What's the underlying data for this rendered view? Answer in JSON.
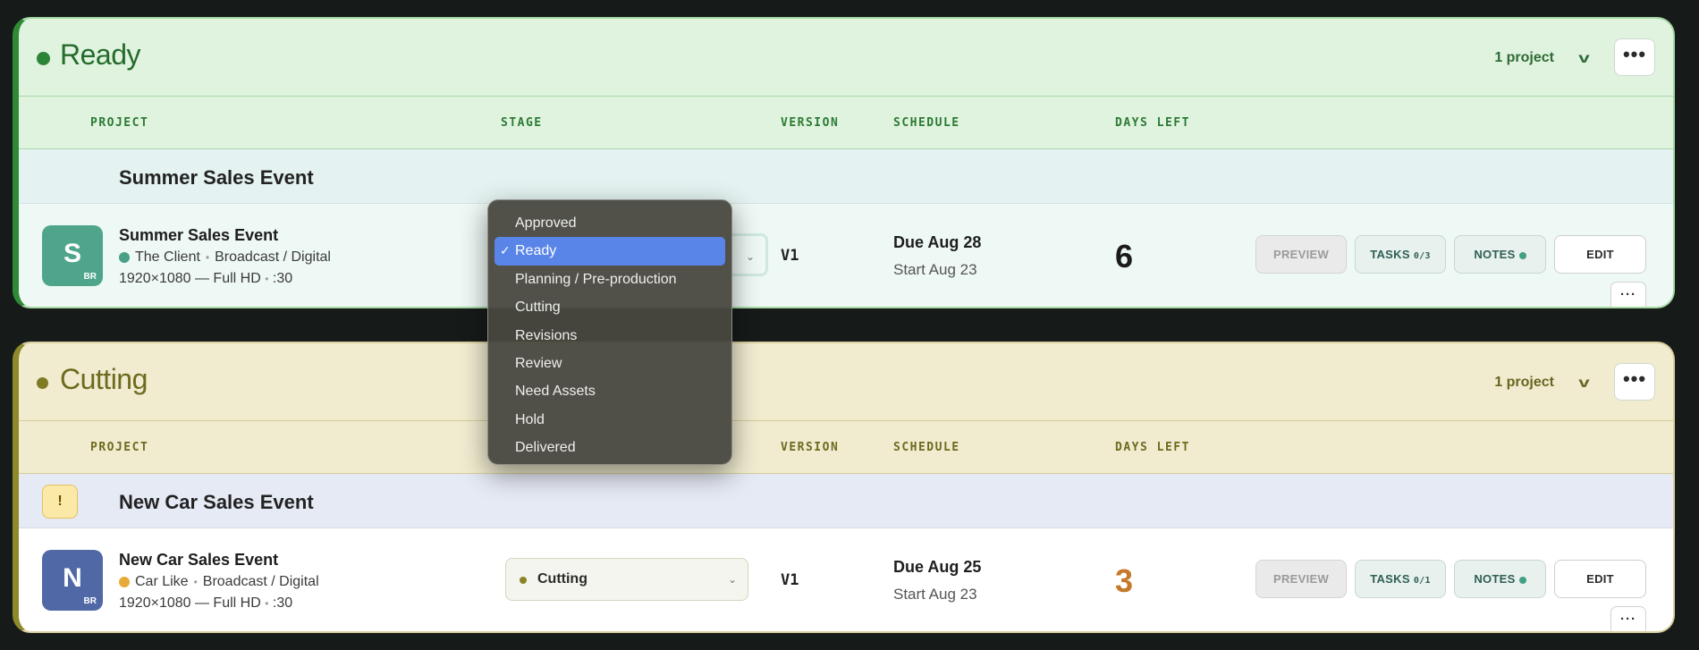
{
  "columns": {
    "project": "PROJECT",
    "stage": "STAGE",
    "version": "VERSION",
    "schedule": "SCHEDULE",
    "days_left": "DAYS LEFT"
  },
  "panels": [
    {
      "status": "Ready",
      "count": "1 project",
      "color": "#2f8a35",
      "group_title": "Summer Sales Event",
      "project": {
        "avatar_letter": "S",
        "avatar_sub": "BR",
        "name": "Summer Sales Event",
        "client": "The Client",
        "type": "Broadcast / Digital",
        "spec": "1920×1080 — Full HD",
        "duration": ":30",
        "version": "V1",
        "due": "Due Aug 28",
        "start": "Start Aug 23",
        "days_left": "6"
      }
    },
    {
      "status": "Cutting",
      "count": "1 project",
      "color": "#8e8a2b",
      "group_title": "New Car Sales Event",
      "warning": "!",
      "project": {
        "avatar_letter": "N",
        "avatar_sub": "BR",
        "name": "New Car Sales Event",
        "client": "Car Like",
        "type": "Broadcast / Digital",
        "spec": "1920×1080 — Full HD",
        "duration": ":30",
        "stage": "Cutting",
        "version": "V1",
        "due": "Due Aug 25",
        "start": "Start Aug 23",
        "days_left": "3"
      }
    }
  ],
  "actions": {
    "preview": "PREVIEW",
    "tasks": "TASKS",
    "tasks_count_ready": "0/3",
    "tasks_count_cutting": "0/1",
    "notes": "NOTES",
    "edit": "EDIT",
    "more": "•••",
    "more_small": "···"
  },
  "stage_dropdown": {
    "selected": "Ready",
    "check": "✓",
    "options": [
      "Approved",
      "Ready",
      "Planning / Pre-production",
      "Cutting",
      "Revisions",
      "Review",
      "Need Assets",
      "Hold",
      "Delivered"
    ]
  },
  "icons": {
    "chevron": "chevron-down-icon",
    "chevron_glyph": "v",
    "select_chevron_glyph": "⌄"
  }
}
